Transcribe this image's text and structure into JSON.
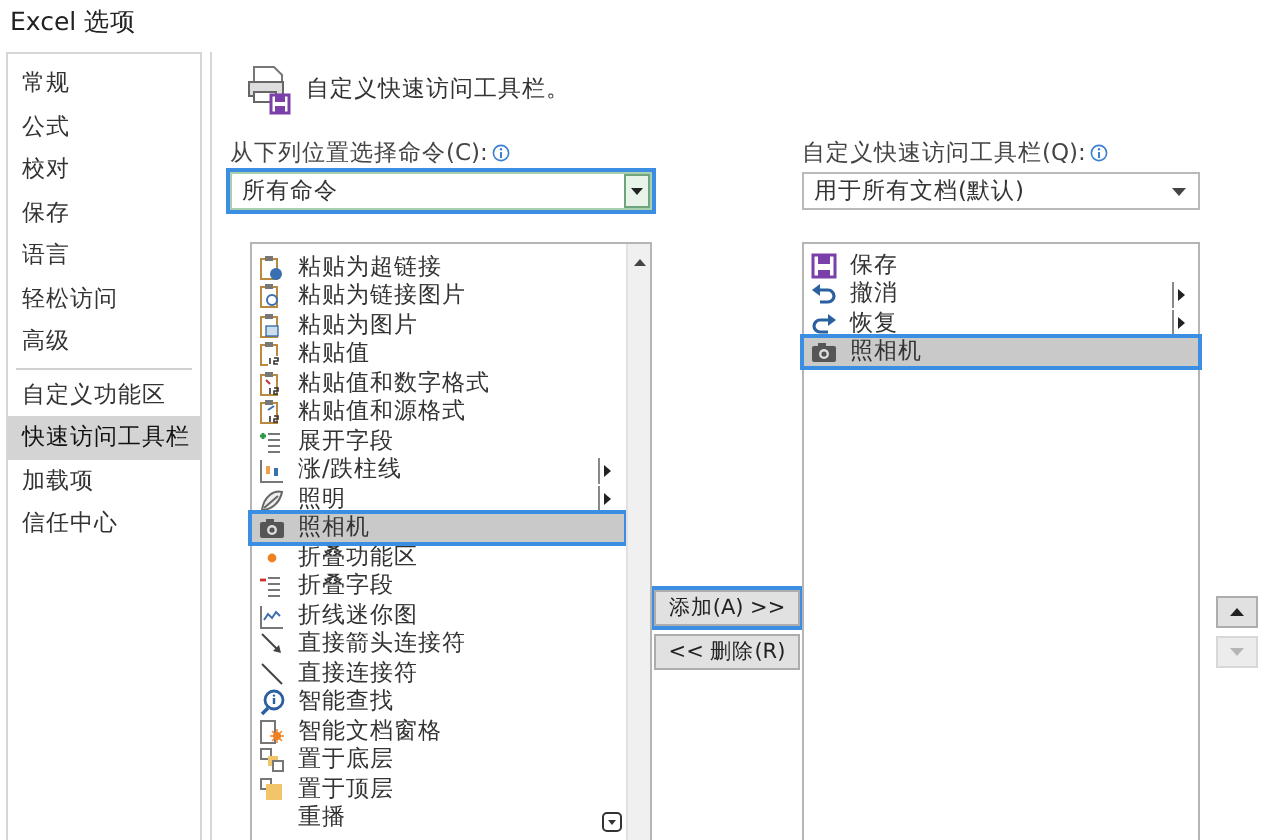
{
  "window": {
    "title": "Excel 选项"
  },
  "sidebar": {
    "items": [
      {
        "label": "常规",
        "selected": false,
        "separator_before": false
      },
      {
        "label": "公式",
        "selected": false,
        "separator_before": false
      },
      {
        "label": "校对",
        "selected": false,
        "separator_before": false
      },
      {
        "label": "保存",
        "selected": false,
        "separator_before": false
      },
      {
        "label": "语言",
        "selected": false,
        "separator_before": false
      },
      {
        "label": "轻松访问",
        "selected": false,
        "separator_before": false
      },
      {
        "label": "高级",
        "selected": false,
        "separator_before": false
      },
      {
        "label": "自定义功能区",
        "selected": false,
        "separator_before": true
      },
      {
        "label": "快速访问工具栏",
        "selected": true,
        "separator_before": false
      },
      {
        "label": "加载项",
        "selected": false,
        "separator_before": false
      },
      {
        "label": "信任中心",
        "selected": false,
        "separator_before": false
      }
    ]
  },
  "heading": "自定义快速访问工具栏。",
  "source": {
    "label": "从下列位置选择命令(C):",
    "value": "所有命令",
    "highlighted": true
  },
  "commands": [
    {
      "label": "粘贴为超链接",
      "submenu": false,
      "selected": false,
      "highlighted": false
    },
    {
      "label": "粘贴为链接图片",
      "submenu": false,
      "selected": false,
      "highlighted": false
    },
    {
      "label": "粘贴为图片",
      "submenu": false,
      "selected": false,
      "highlighted": false
    },
    {
      "label": "粘贴值",
      "submenu": false,
      "selected": false,
      "highlighted": false
    },
    {
      "label": "粘贴值和数字格式",
      "submenu": false,
      "selected": false,
      "highlighted": false
    },
    {
      "label": "粘贴值和源格式",
      "submenu": false,
      "selected": false,
      "highlighted": false
    },
    {
      "label": "展开字段",
      "submenu": false,
      "selected": false,
      "highlighted": false
    },
    {
      "label": "涨/跌柱线",
      "submenu": true,
      "selected": false,
      "highlighted": false
    },
    {
      "label": "照明",
      "submenu": true,
      "selected": false,
      "highlighted": false
    },
    {
      "label": "照相机",
      "submenu": false,
      "selected": true,
      "highlighted": true
    },
    {
      "label": "折叠功能区",
      "submenu": false,
      "selected": false,
      "highlighted": false
    },
    {
      "label": "折叠字段",
      "submenu": false,
      "selected": false,
      "highlighted": false
    },
    {
      "label": "折线迷你图",
      "submenu": false,
      "selected": false,
      "highlighted": false
    },
    {
      "label": "直接箭头连接符",
      "submenu": false,
      "selected": false,
      "highlighted": false
    },
    {
      "label": "直接连接符",
      "submenu": false,
      "selected": false,
      "highlighted": false
    },
    {
      "label": "智能查找",
      "submenu": false,
      "selected": false,
      "highlighted": false
    },
    {
      "label": "智能文档窗格",
      "submenu": false,
      "selected": false,
      "highlighted": false
    },
    {
      "label": "置于底层",
      "submenu": false,
      "selected": false,
      "highlighted": false
    },
    {
      "label": "置于顶层",
      "submenu": false,
      "selected": false,
      "highlighted": false
    },
    {
      "label": "重播",
      "submenu": false,
      "selected": false,
      "highlighted": false
    }
  ],
  "add_button": {
    "label": "添加(A) >>",
    "highlighted": true
  },
  "remove_button": {
    "label": "<< 删除(R)",
    "highlighted": false
  },
  "target": {
    "label": "自定义快速访问工具栏(Q):",
    "value": "用于所有文档(默认)",
    "highlighted": false
  },
  "toolbar_items": [
    {
      "label": "保存",
      "submenu": false,
      "selected": false,
      "highlighted": false
    },
    {
      "label": "撤消",
      "submenu": true,
      "selected": false,
      "highlighted": false
    },
    {
      "label": "恢复",
      "submenu": true,
      "selected": false,
      "highlighted": false
    },
    {
      "label": "照相机",
      "submenu": false,
      "selected": true,
      "highlighted": true
    }
  ],
  "move_up": {
    "disabled": false
  },
  "move_down": {
    "disabled": true
  }
}
